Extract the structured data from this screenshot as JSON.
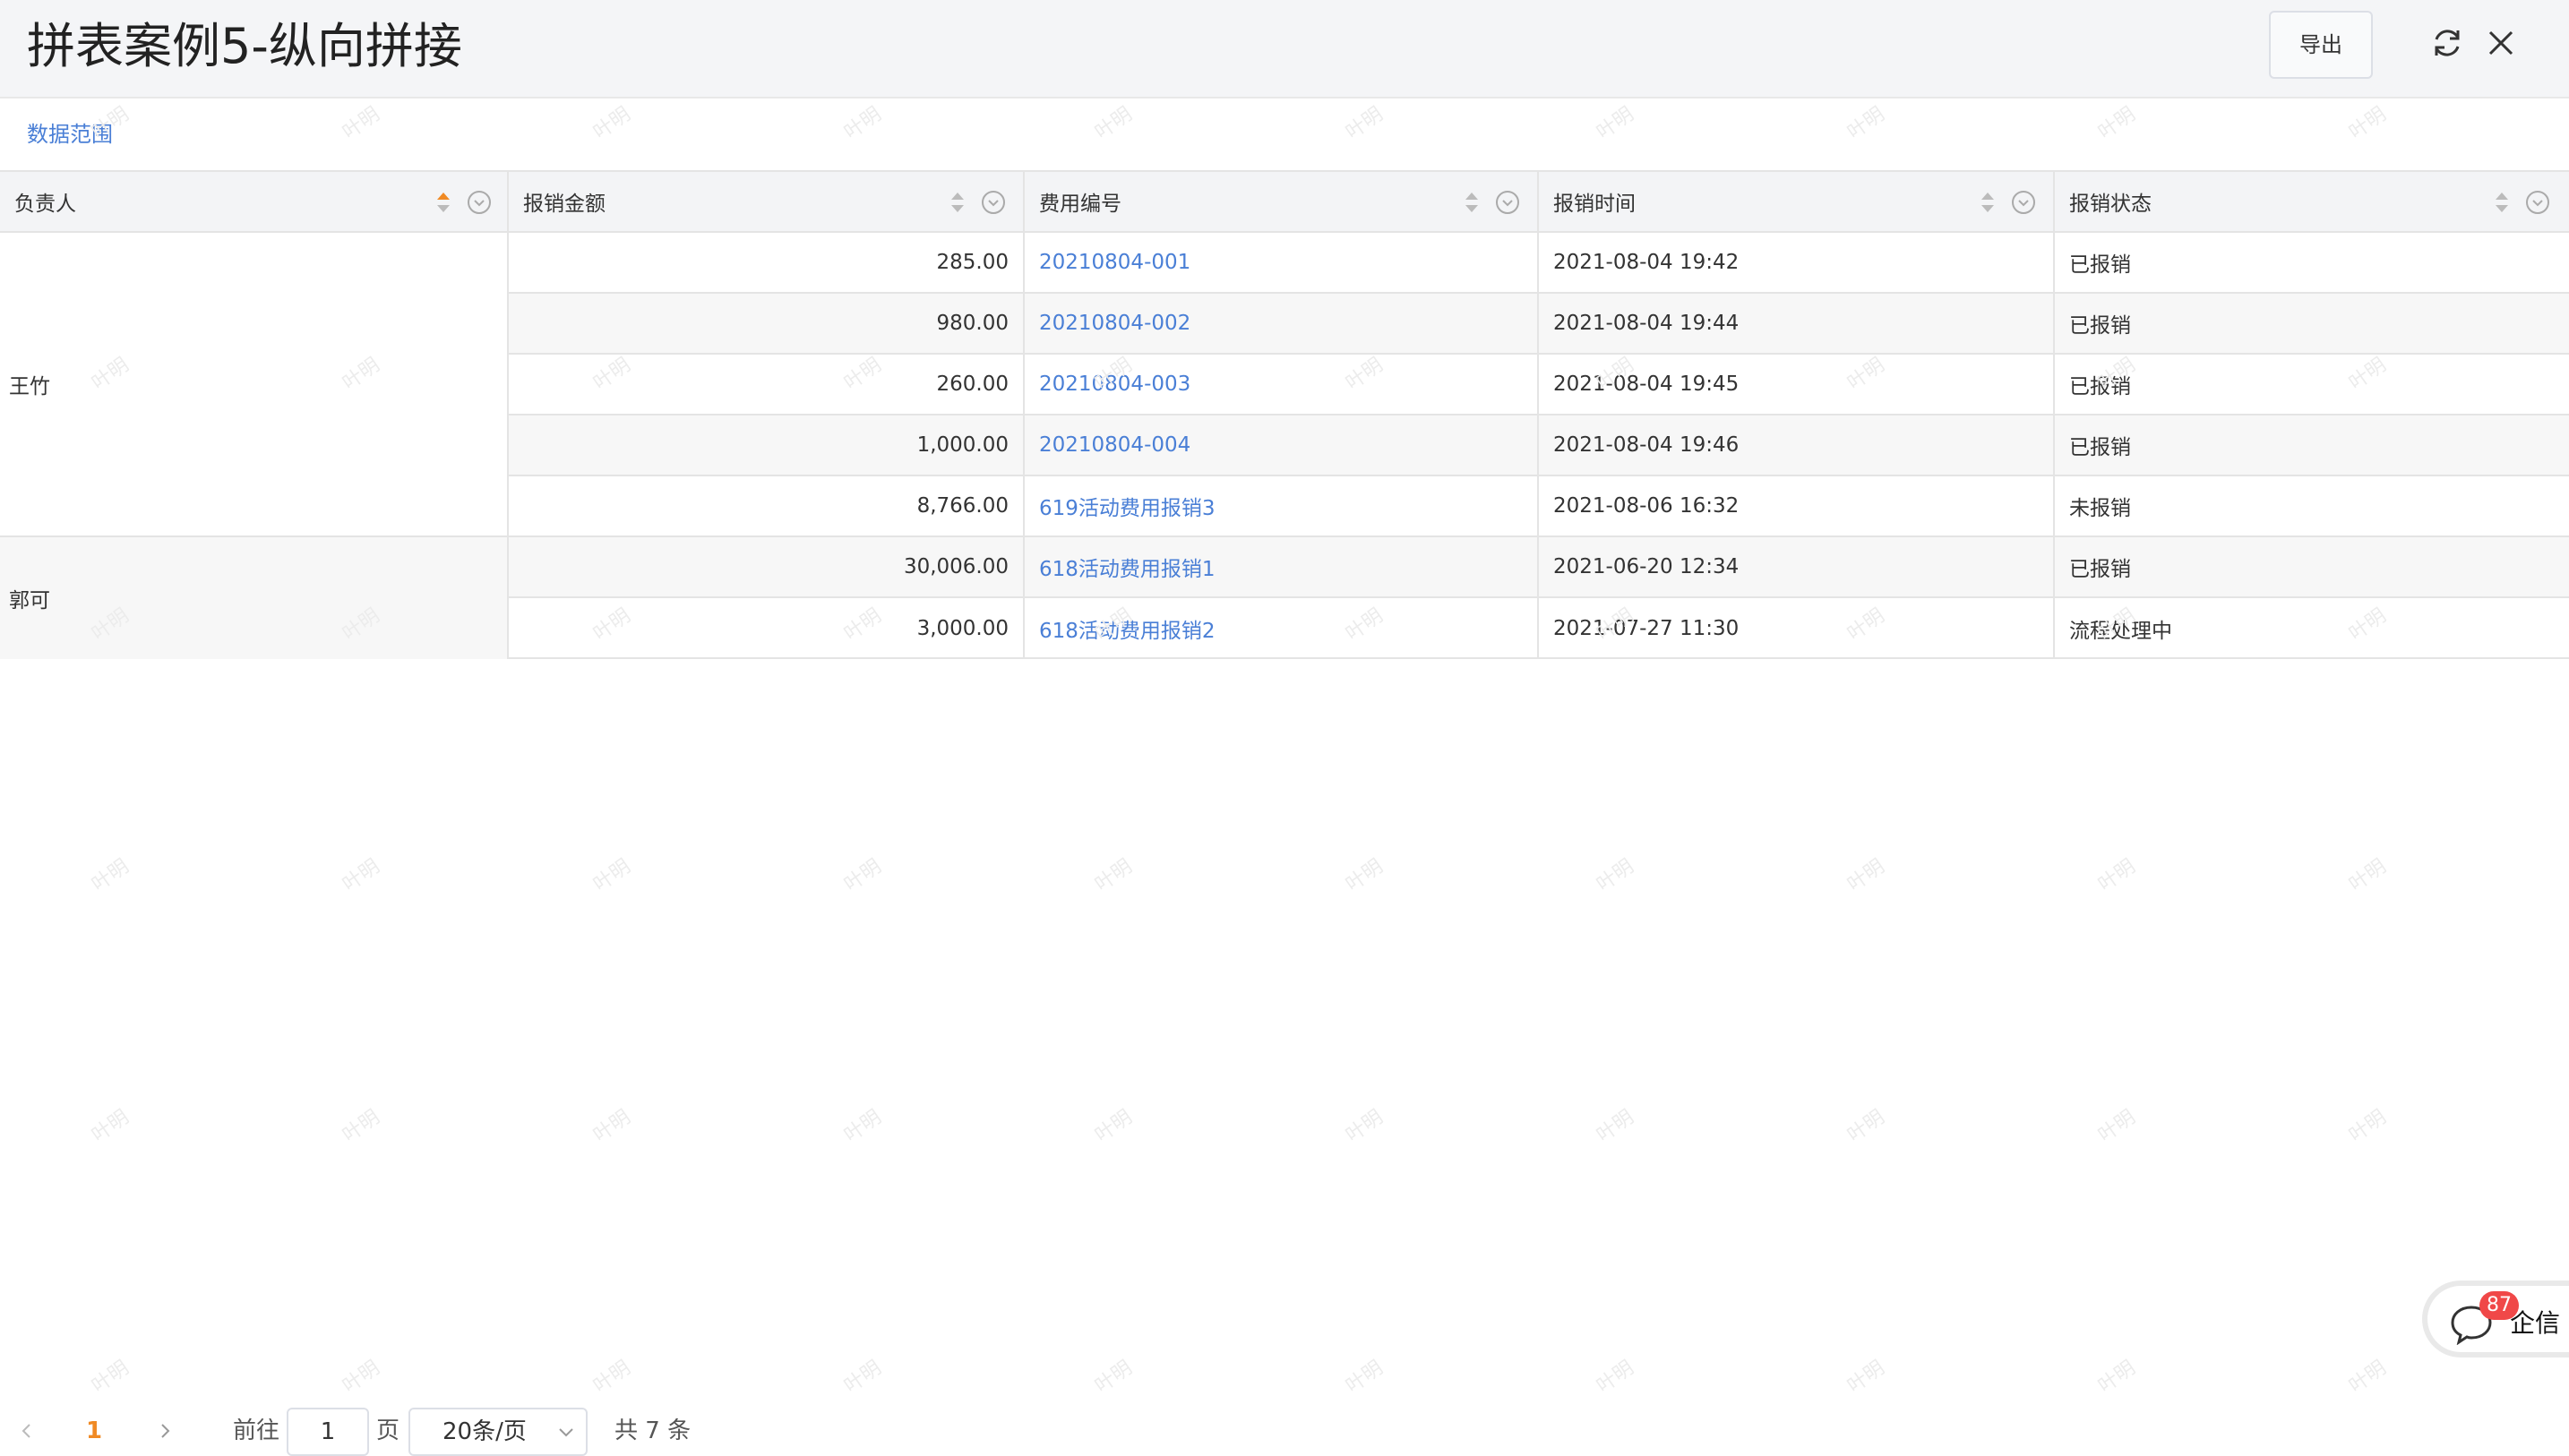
{
  "header": {
    "title": "拼表案例5-纵向拼接",
    "export_label": "导出",
    "icons": [
      "refresh-icon",
      "close-icon"
    ]
  },
  "filter": {
    "scope_label": "数据范围"
  },
  "table": {
    "columns": [
      "负责人",
      "报销金额",
      "费用编号",
      "报销时间",
      "报销状态"
    ],
    "groups": [
      {
        "person": "王竹",
        "rows": [
          {
            "amount": "285.00",
            "code": "20210804-001",
            "time": "2021-08-04 19:42",
            "status": "已报销"
          },
          {
            "amount": "980.00",
            "code": "20210804-002",
            "time": "2021-08-04 19:44",
            "status": "已报销"
          },
          {
            "amount": "260.00",
            "code": "20210804-003",
            "time": "2021-08-04 19:45",
            "status": "已报销"
          },
          {
            "amount": "1,000.00",
            "code": "20210804-004",
            "time": "2021-08-04 19:46",
            "status": "已报销"
          },
          {
            "amount": "8,766.00",
            "code": "619活动费用报销3",
            "time": "2021-08-06 16:32",
            "status": "未报销"
          }
        ]
      },
      {
        "person": "郭可",
        "rows": [
          {
            "amount": "30,006.00",
            "code": "618活动费用报销1",
            "time": "2021-06-20 12:34",
            "status": "已报销"
          },
          {
            "amount": "3,000.00",
            "code": "618活动费用报销2",
            "time": "2021-07-27 11:30",
            "status": "流程处理中"
          }
        ]
      }
    ]
  },
  "pagination": {
    "current_page": "1",
    "goto_label": "前往",
    "page_input_value": "1",
    "page_unit": "页",
    "page_size": "20条/页",
    "total_text": "共 7 条"
  },
  "chat_widget": {
    "badge_count": "87",
    "label": "企信"
  },
  "watermark_text": "叶明",
  "colors": {
    "link": "#4a7fd6",
    "sort_active": "#f08a24",
    "badge": "#f04848"
  }
}
